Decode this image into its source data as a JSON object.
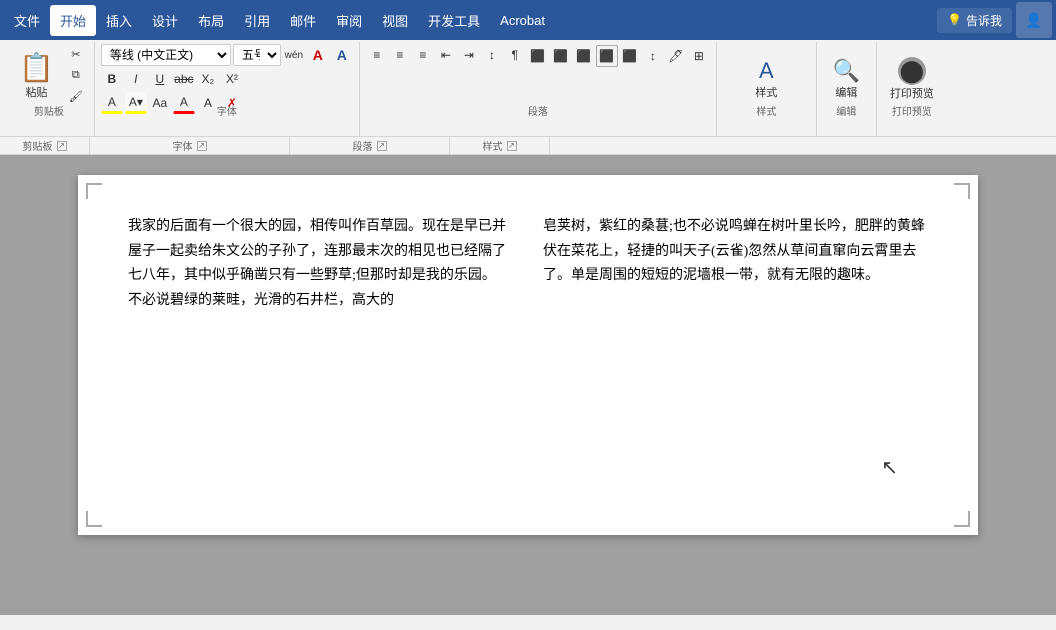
{
  "menubar": {
    "items": [
      "文件",
      "开始",
      "插入",
      "设计",
      "布局",
      "引用",
      "邮件",
      "审阅",
      "视图",
      "开发工具",
      "Acrobat"
    ],
    "active": "开始",
    "tell_me": "告诉我",
    "tell_me_icon": "🔍"
  },
  "ribbon": {
    "groups": {
      "clipboard": {
        "label": "剪贴板",
        "paste": "粘贴",
        "cut": "✂",
        "copy": "📋",
        "format_painter": "🖌"
      },
      "font": {
        "label": "字体",
        "name": "等线 (中文正文)",
        "size": "五号",
        "wen": "wén",
        "font_buttons": [
          "B",
          "I",
          "U",
          "abc",
          "X₂",
          "X²"
        ],
        "color_buttons": [
          "A",
          "A",
          "Aa",
          "A",
          "A",
          "✗"
        ]
      },
      "paragraph": {
        "label": "段落",
        "buttons": [
          "≡",
          "≡",
          "≡",
          "≡",
          "≡",
          "↕",
          "↔",
          "¶"
        ]
      },
      "styles": {
        "label": "样式",
        "name": "样式"
      },
      "editing": {
        "label": "编辑",
        "name": "编辑"
      },
      "print": {
        "label": "打印预览",
        "name": "打印预览"
      }
    }
  },
  "document": {
    "col1": "我家的后面有一个很大的园，相传叫作百草园。现在是早已并屋子一起卖给朱文公的子孙了，连那最末次的相见也已经隔了七八年，其中似乎确凿只有一些野草;但那时却是我的乐园。\n不必说碧绿的莱畦，光滑的石井栏，高大的",
    "col2": "皂荚树，紫红的桑葚;也不必说鸣蝉在树叶里长吟，肥胖的黄蜂伏在菜花上，轻捷的叫天子(云雀)忽然从草间直窜向云霄里去了。单是周围的短短的泥墙根一带，就有无限的趣味。"
  }
}
